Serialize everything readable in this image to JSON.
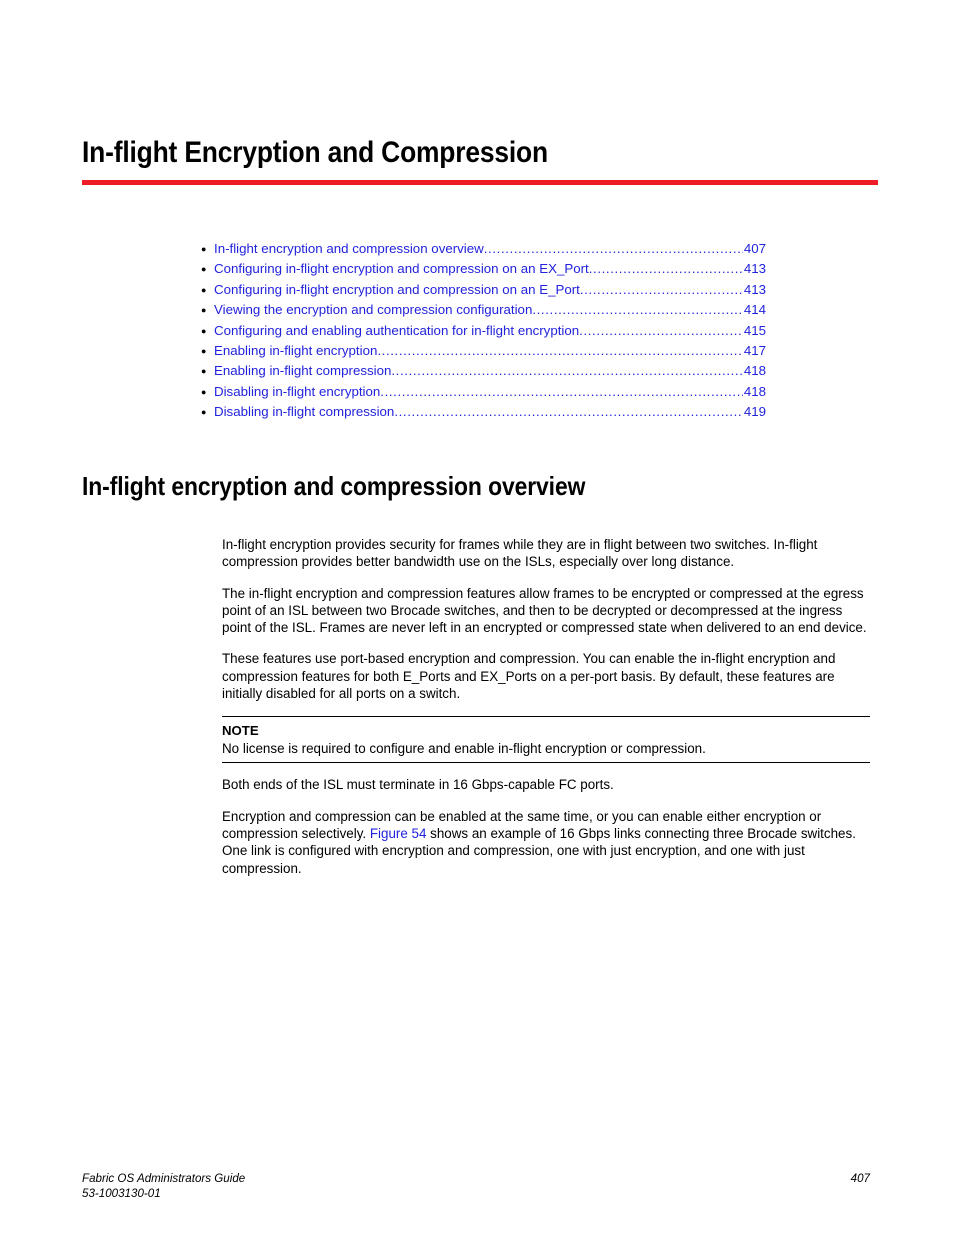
{
  "chapter": {
    "title": "In-flight Encryption and Compression",
    "rule_color": "#ED1C24"
  },
  "toc": {
    "link_color": "#2222DD",
    "items": [
      {
        "label": "In-flight encryption and compression overview",
        "page": "407"
      },
      {
        "label": "Configuring in-flight encryption and compression on an EX_Port",
        "page": "413"
      },
      {
        "label": "Configuring in-flight encryption and compression on an E_Port",
        "page": "413"
      },
      {
        "label": "Viewing the encryption and compression configuration",
        "page": "414"
      },
      {
        "label": "Configuring and enabling authentication for in-flight encryption",
        "page": "415"
      },
      {
        "label": "Enabling in-flight encryption",
        "page": "417"
      },
      {
        "label": "Enabling in-flight compression",
        "page": "418"
      },
      {
        "label": "Disabling in-flight encryption",
        "page": "418"
      },
      {
        "label": "Disabling in-flight compression",
        "page": "419"
      }
    ]
  },
  "section": {
    "heading": "In-flight encryption and compression overview",
    "paragraphs": {
      "p1": "In-flight encryption provides security for frames while they are in flight between two switches. In-flight compression provides better bandwidth use on the ISLs, especially over long distance.",
      "p2": "The in-flight encryption and compression features allow frames to be encrypted or compressed at the egress point of an ISL between two Brocade switches, and then to be decrypted or decompressed at the ingress point of the ISL. Frames are never left in an encrypted or compressed state when delivered to an end device.",
      "p3": "These features use port-based encryption and compression. You can enable the in-flight encryption and compression features for both E_Ports and EX_Ports on a per-port basis. By default, these features are initially disabled for all ports on a switch.",
      "p4": "Both ends of the ISL must terminate in 16 Gbps-capable FC ports.",
      "p5_before_link": "Encryption and compression can be enabled at the same time, or you can enable either encryption or compression selectively. ",
      "p5_link": "Figure 54",
      "p5_after_link": " shows an example of 16 Gbps links connecting three Brocade switches. One link is configured with encryption and compression, one with just encryption, and one with just compression."
    },
    "note": {
      "title": "NOTE",
      "text": "No license is required to configure and enable in-flight encryption or compression."
    }
  },
  "footer": {
    "guide_title": "Fabric OS Administrators Guide",
    "doc_number": "53-1003130-01",
    "page_number": "407"
  }
}
